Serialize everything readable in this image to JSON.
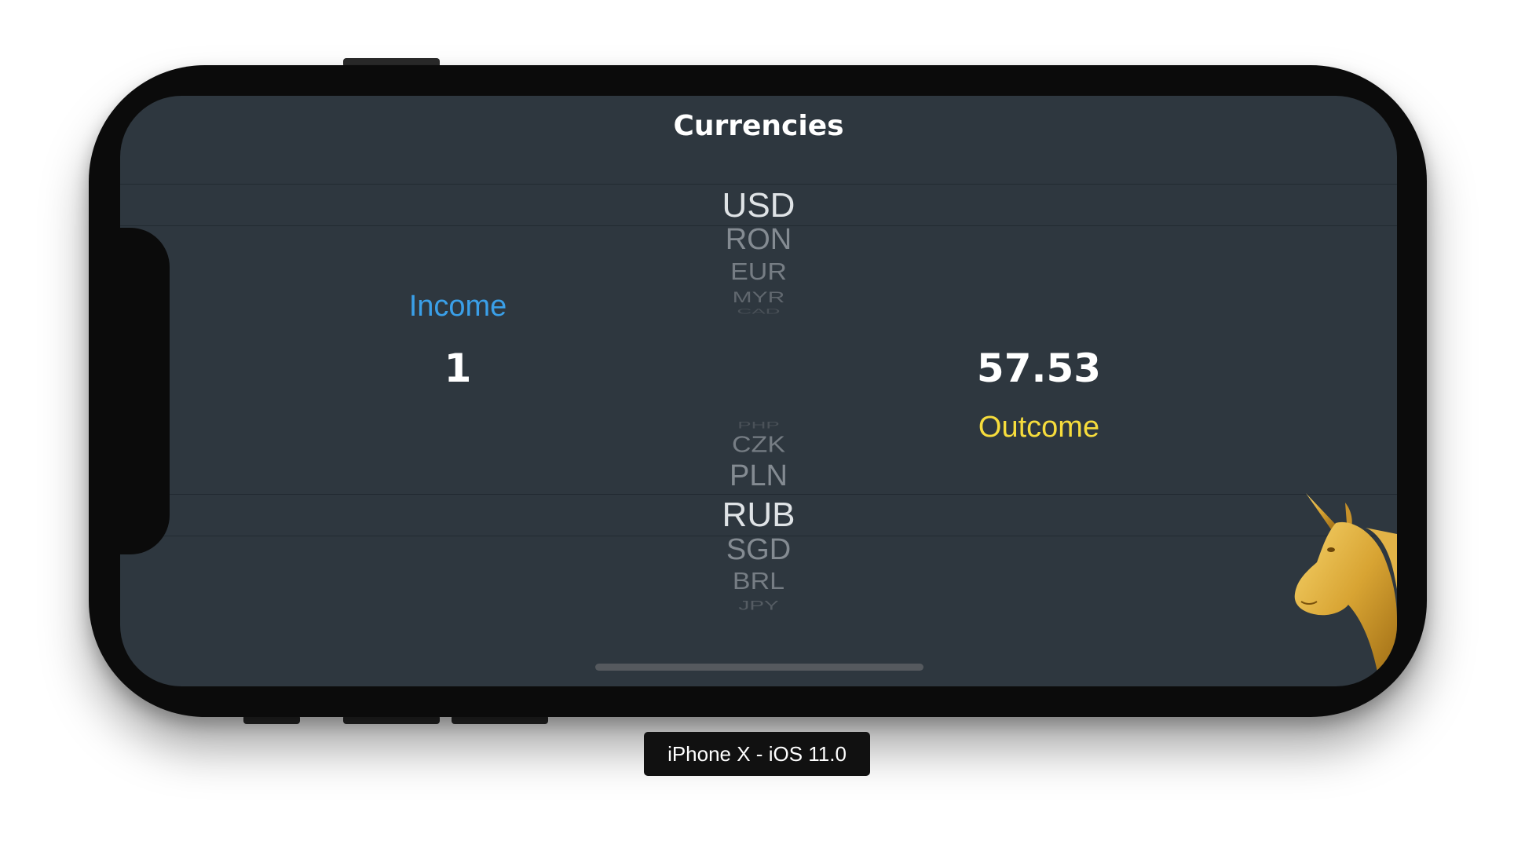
{
  "nav": {
    "title": "Currencies"
  },
  "picker_top": {
    "selected": "USD",
    "items": [
      "RON",
      "EUR",
      "MYR",
      "CAD"
    ]
  },
  "picker_bottom": {
    "above": [
      "PHP",
      "CZK",
      "PLN"
    ],
    "selected": "RUB",
    "below": [
      "SGD",
      "BRL",
      "JPY"
    ]
  },
  "income": {
    "label": "Income",
    "value": "1"
  },
  "outcome": {
    "label": "Outcome",
    "value": "57.53"
  },
  "device_label": "iPhone X - iOS 11.0",
  "colors": {
    "screen_bg": "#2e373f",
    "income_accent": "#3a9fe8",
    "outcome_accent": "#f6dc3c"
  },
  "icons": {
    "mascot": "golden-unicorn-icon"
  }
}
